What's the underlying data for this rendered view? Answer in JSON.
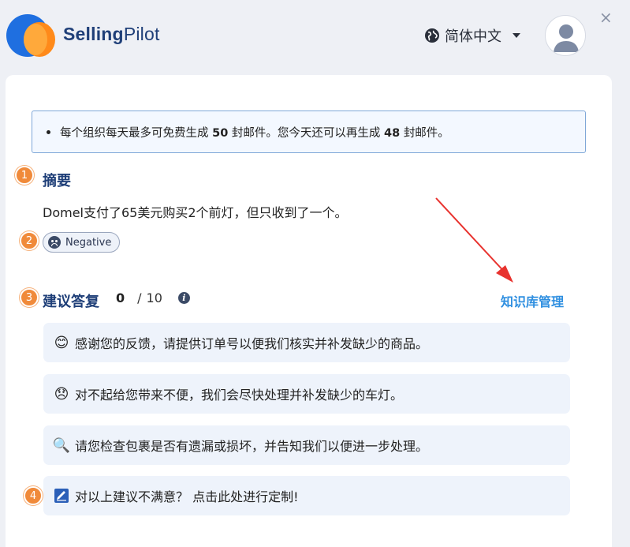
{
  "header": {
    "brand_bold": "Selling",
    "brand_light": "Pilot",
    "language": "简体中文",
    "close_glyph": "×"
  },
  "notice": {
    "text_prefix": "每个组织每天最多可免费生成",
    "daily_limit": "50",
    "text_middle": "封邮件。您今天还可以再生成",
    "remaining": "48",
    "text_suffix": "封邮件。"
  },
  "steps": [
    "1",
    "2",
    "3",
    "4"
  ],
  "summary": {
    "title": "摘要",
    "text": "Domel支付了65美元购买2个前灯，但只收到了一个。",
    "sentiment_label": "Negative",
    "sentiment_icon": "sad-face-icon"
  },
  "suggestions": {
    "title": "建议答复",
    "count_used": "0",
    "count_sep": "/",
    "count_total": "10",
    "info_glyph": "i",
    "kb_link": "知识库管理",
    "items": [
      {
        "icon": "smile-emoji",
        "glyph": "😊",
        "text": "感谢您的反馈，请提供订单号以便我们核实并补发缺少的商品。"
      },
      {
        "icon": "disappointed-emoji",
        "glyph": "😞",
        "text": "对不起给您带来不便，我们会尽快处理并补发缺少的车灯。"
      },
      {
        "icon": "magnifier-emoji",
        "glyph": "🔍",
        "text": "请您检查包裹是否有遗漏或损坏，并告知我们以便进一步处理。"
      }
    ],
    "customize": {
      "icon": "edit-emoji",
      "text": "对以上建议不满意？ 点击此处进行定制!"
    }
  },
  "colors": {
    "accent_blue": "#2f8fe0",
    "title_navy": "#1f3f78",
    "step_orange": "#f08a3a",
    "arrow_red": "#e8322e"
  }
}
